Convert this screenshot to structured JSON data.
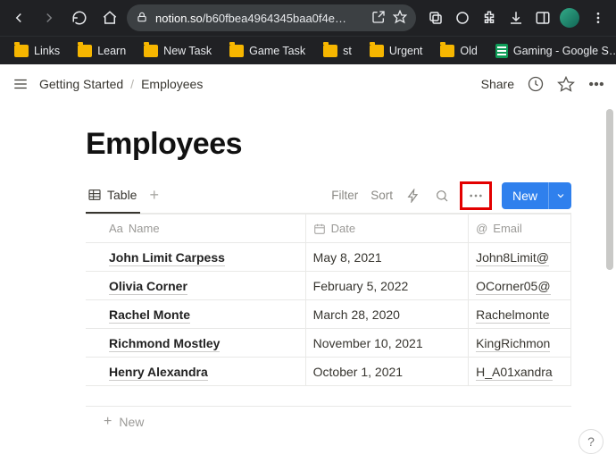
{
  "browser": {
    "url_domain": "notion.so",
    "url_path": "/b60fbea4964345baa0f4e…",
    "bookmarks": [
      "Links",
      "Learn",
      "New Task",
      "Game Task",
      "st",
      "Urgent",
      "Old"
    ],
    "sheets_bookmark": "Gaming - Google S…"
  },
  "topbar": {
    "breadcrumb_root": "Getting Started",
    "breadcrumb_current": "Employees",
    "share_label": "Share"
  },
  "page": {
    "title": "Employees"
  },
  "views": {
    "active_label": "Table"
  },
  "table_controls": {
    "filter_label": "Filter",
    "sort_label": "Sort",
    "new_label": "New"
  },
  "columns": {
    "name": "Name",
    "date": "Date",
    "email": "Email"
  },
  "rows": [
    {
      "name": "John Limit Carpess",
      "date": "May 8, 2021",
      "email": "John8Limit@"
    },
    {
      "name": "Olivia Corner",
      "date": "February 5, 2022",
      "email": "OCorner05@"
    },
    {
      "name": "Rachel Monte",
      "date": "March 28, 2020",
      "email": "Rachelmonte"
    },
    {
      "name": "Richmond Mostley",
      "date": "November 10, 2021",
      "email": "KingRichmon"
    },
    {
      "name": "Henry Alexandra",
      "date": "October 1, 2021",
      "email": "H_A01xandra"
    }
  ],
  "add_row_label": "New",
  "help_label": "?"
}
